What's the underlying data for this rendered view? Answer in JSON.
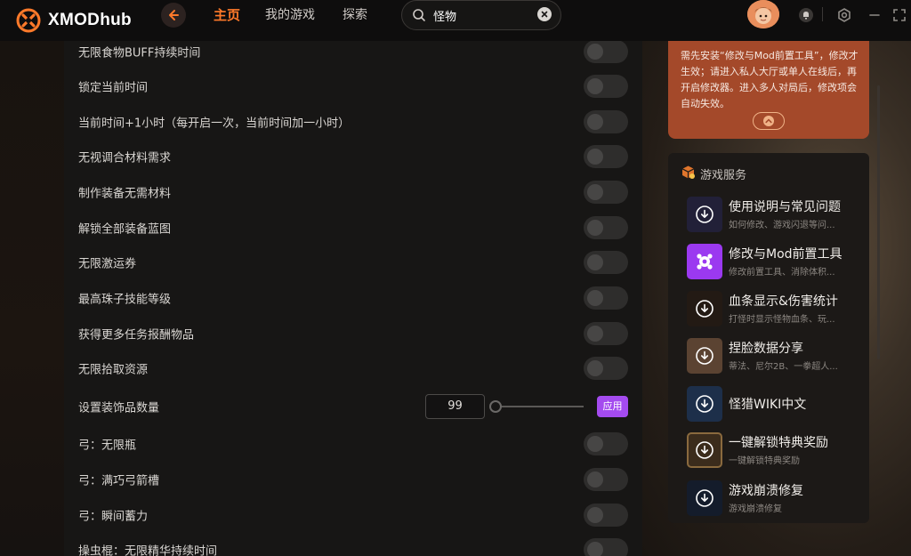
{
  "app": {
    "logo_text": "XMODhub"
  },
  "nav": {
    "tabs": [
      {
        "label": "主页"
      },
      {
        "label": "我的游戏"
      },
      {
        "label": "探索"
      }
    ]
  },
  "search": {
    "value": "怪物"
  },
  "settings": {
    "rows": [
      {
        "label": "无限食物BUFF持续时间"
      },
      {
        "label": "锁定当前时间"
      },
      {
        "label": "当前时间+1小时（每开启一次，当前时间加一小时）"
      },
      {
        "label": "无视调合材料需求"
      },
      {
        "label": "制作装备无需材料"
      },
      {
        "label": "解锁全部装备蓝图"
      },
      {
        "label": "无限激运券"
      },
      {
        "label": "最高珠子技能等级"
      },
      {
        "label": "获得更多任务报酬物品"
      },
      {
        "label": "无限拾取资源"
      },
      {
        "label": "设置装饰品数量",
        "value": "99",
        "apply_label": "应用"
      },
      {
        "label": "弓：无限瓶"
      },
      {
        "label": "弓：满巧弓箭槽"
      },
      {
        "label": "弓：瞬间蓄力"
      },
      {
        "label": "操虫棍：无限精华持续时间"
      }
    ]
  },
  "notice": {
    "text": "需先安装“修改与Mod前置工具”，修改才生效；请进入私人大厅或单人在线后，再开启修改器。进入多人对局后，修改项会自动失效。"
  },
  "services": {
    "title": "游戏服务",
    "items": [
      {
        "title": "使用说明与常见问题",
        "subtitle": "如何修改、游戏闪退等问..."
      },
      {
        "title": "修改与Mod前置工具",
        "subtitle": "修改前置工具、消除体积..."
      },
      {
        "title": "血条显示&伤害统计",
        "subtitle": "打怪时显示怪物血条、玩..."
      },
      {
        "title": "捏脸数据分享",
        "subtitle": "蒂法、尼尔2B、一拳超人..."
      },
      {
        "title": "怪猎WIKI中文",
        "subtitle": ""
      },
      {
        "title": "一键解锁特典奖励",
        "subtitle": "一键解锁特典奖励"
      },
      {
        "title": "游戏崩溃修复",
        "subtitle": "游戏崩溃修复"
      }
    ]
  },
  "colors": {
    "accent": "#ff7a2a",
    "apply": "#a44bef",
    "notice_bg": "#a4492a"
  }
}
